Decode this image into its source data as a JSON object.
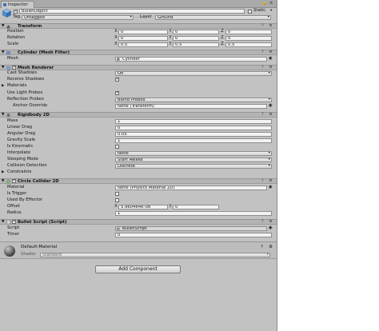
{
  "tab": {
    "label": "Inspector",
    "lock": "🔒",
    "menu": "≡"
  },
  "header": {
    "name": "BulletObject",
    "static_label": "Static",
    "tag_label": "Tag",
    "tag_value": "Untagged",
    "layer_label": "Layer",
    "layer_value": "Ground"
  },
  "transform": {
    "title": "Transform",
    "rows": [
      {
        "label": "Position",
        "x": "0",
        "y": "0",
        "z": "0"
      },
      {
        "label": "Rotation",
        "x": "0",
        "y": "0",
        "z": "0"
      },
      {
        "label": "Scale",
        "x": "0.5",
        "y": "0.5",
        "z": "0.5"
      }
    ],
    "axis": {
      "x": "X",
      "y": "Y",
      "z": "Z"
    }
  },
  "mesh_filter": {
    "title": "Cylinder (Mesh Filter)",
    "mesh_label": "Mesh",
    "mesh_value": "Cylinder"
  },
  "mesh_renderer": {
    "title": "Mesh Renderer",
    "cast_shadows_label": "Cast Shadows",
    "cast_shadows_value": "On",
    "receive_shadows_label": "Receive Shadows",
    "materials_label": "Materials",
    "use_light_probes_label": "Use Light Probes",
    "reflection_probes_label": "Reflection Probes",
    "reflection_probes_value": "Blend Probes",
    "anchor_override_label": "Anchor Override",
    "anchor_override_value": "None (Transform)"
  },
  "rigidbody": {
    "title": "Rigidbody 2D",
    "mass_label": "Mass",
    "mass_value": "1",
    "linear_drag_label": "Linear Drag",
    "linear_drag_value": "0",
    "angular_drag_label": "Angular Drag",
    "angular_drag_value": "0.05",
    "gravity_label": "Gravity Scale",
    "gravity_value": "1",
    "kinematic_label": "Is Kinematic",
    "interpolate_label": "Interpolate",
    "interpolate_value": "None",
    "sleeping_label": "Sleeping Mode",
    "sleeping_value": "Start Awake",
    "collision_label": "Collision Detection",
    "collision_value": "Discrete",
    "constraints_label": "Constraints"
  },
  "circle_collider": {
    "title": "Circle Collider 2D",
    "material_label": "Material",
    "material_value": "None (Physics Material 2D)",
    "trigger_label": "Is Trigger",
    "effector_label": "Used By Effector",
    "offset_label": "Offset",
    "offset_x": "5.960464e-08",
    "offset_y": "0",
    "radius_label": "Radius",
    "radius_value": "1"
  },
  "bullet_script": {
    "title": "Bullet Script (Script)",
    "script_label": "Script",
    "script_value": "BulletScript",
    "timer_label": "Timer",
    "timer_value": "0"
  },
  "material": {
    "name": "Default-Material",
    "shader_label": "Shader",
    "shader_value": "Standard"
  },
  "add_component": "Add Component",
  "icons": {
    "gear": "⚙",
    "help": "?",
    "fold_open": "▼",
    "fold_closed": "▶"
  }
}
